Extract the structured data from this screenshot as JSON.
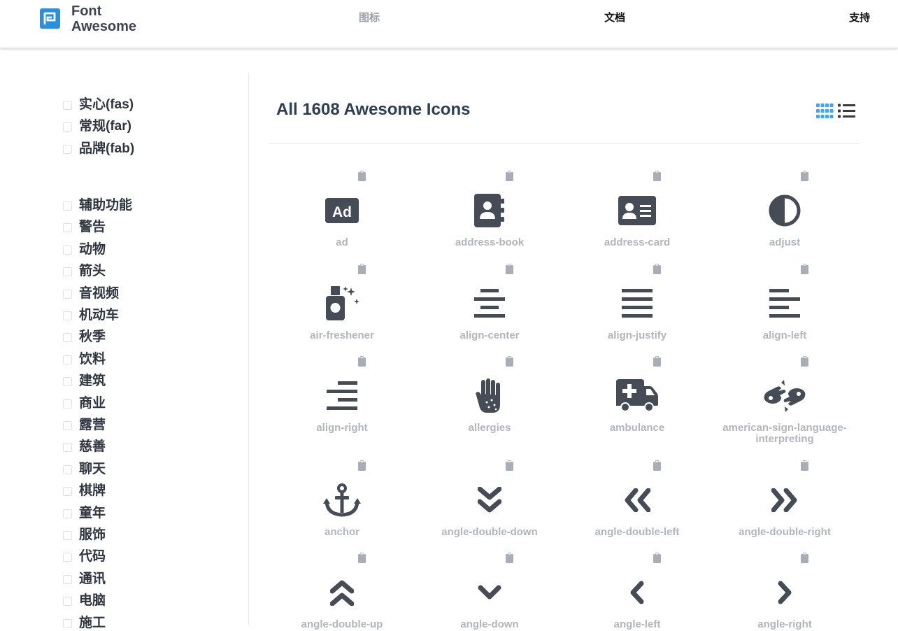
{
  "header": {
    "logo_text": "Font Awesome",
    "nav": {
      "icons": "图标",
      "docs": "文档",
      "support": "支持"
    }
  },
  "sidebar": {
    "styles": [
      "实心(fas)",
      "常规(far)",
      "品牌(fab)"
    ],
    "categories": [
      "辅助功能",
      "警告",
      "动物",
      "箭头",
      "音视频",
      "机动车",
      "秋季",
      "饮料",
      "建筑",
      "商业",
      "露营",
      "慈善",
      "聊天",
      "棋牌",
      "童年",
      "服饰",
      "代码",
      "通讯",
      "电脑",
      "施工"
    ]
  },
  "main": {
    "title": "All 1608 Awesome Icons",
    "icons": [
      {
        "name": "ad",
        "icon": "ad-icon"
      },
      {
        "name": "address-book",
        "icon": "address-book-icon"
      },
      {
        "name": "address-card",
        "icon": "address-card-icon"
      },
      {
        "name": "adjust",
        "icon": "adjust-icon"
      },
      {
        "name": "air-freshener",
        "icon": "air-freshener-icon"
      },
      {
        "name": "align-center",
        "icon": "align-center-icon"
      },
      {
        "name": "align-justify",
        "icon": "align-justify-icon"
      },
      {
        "name": "align-left",
        "icon": "align-left-icon"
      },
      {
        "name": "align-right",
        "icon": "align-right-icon"
      },
      {
        "name": "allergies",
        "icon": "allergies-icon"
      },
      {
        "name": "ambulance",
        "icon": "ambulance-icon"
      },
      {
        "name": "american-sign-language-interpreting",
        "icon": "american-sign-language-interpreting-icon"
      },
      {
        "name": "anchor",
        "icon": "anchor-icon"
      },
      {
        "name": "angle-double-down",
        "icon": "angle-double-down-icon"
      },
      {
        "name": "angle-double-left",
        "icon": "angle-double-left-icon"
      },
      {
        "name": "angle-double-right",
        "icon": "angle-double-right-icon"
      },
      {
        "name": "angle-double-up",
        "icon": "angle-double-up-icon"
      },
      {
        "name": "angle-down",
        "icon": "angle-down-icon"
      },
      {
        "name": "angle-left",
        "icon": "angle-left-icon"
      },
      {
        "name": "angle-right",
        "icon": "angle-right-icon"
      }
    ]
  },
  "colors": {
    "accent": "#4aa3e8",
    "icon": "#454c56",
    "label": "#b1b6bd",
    "clipboard": "#a9aeb6"
  }
}
